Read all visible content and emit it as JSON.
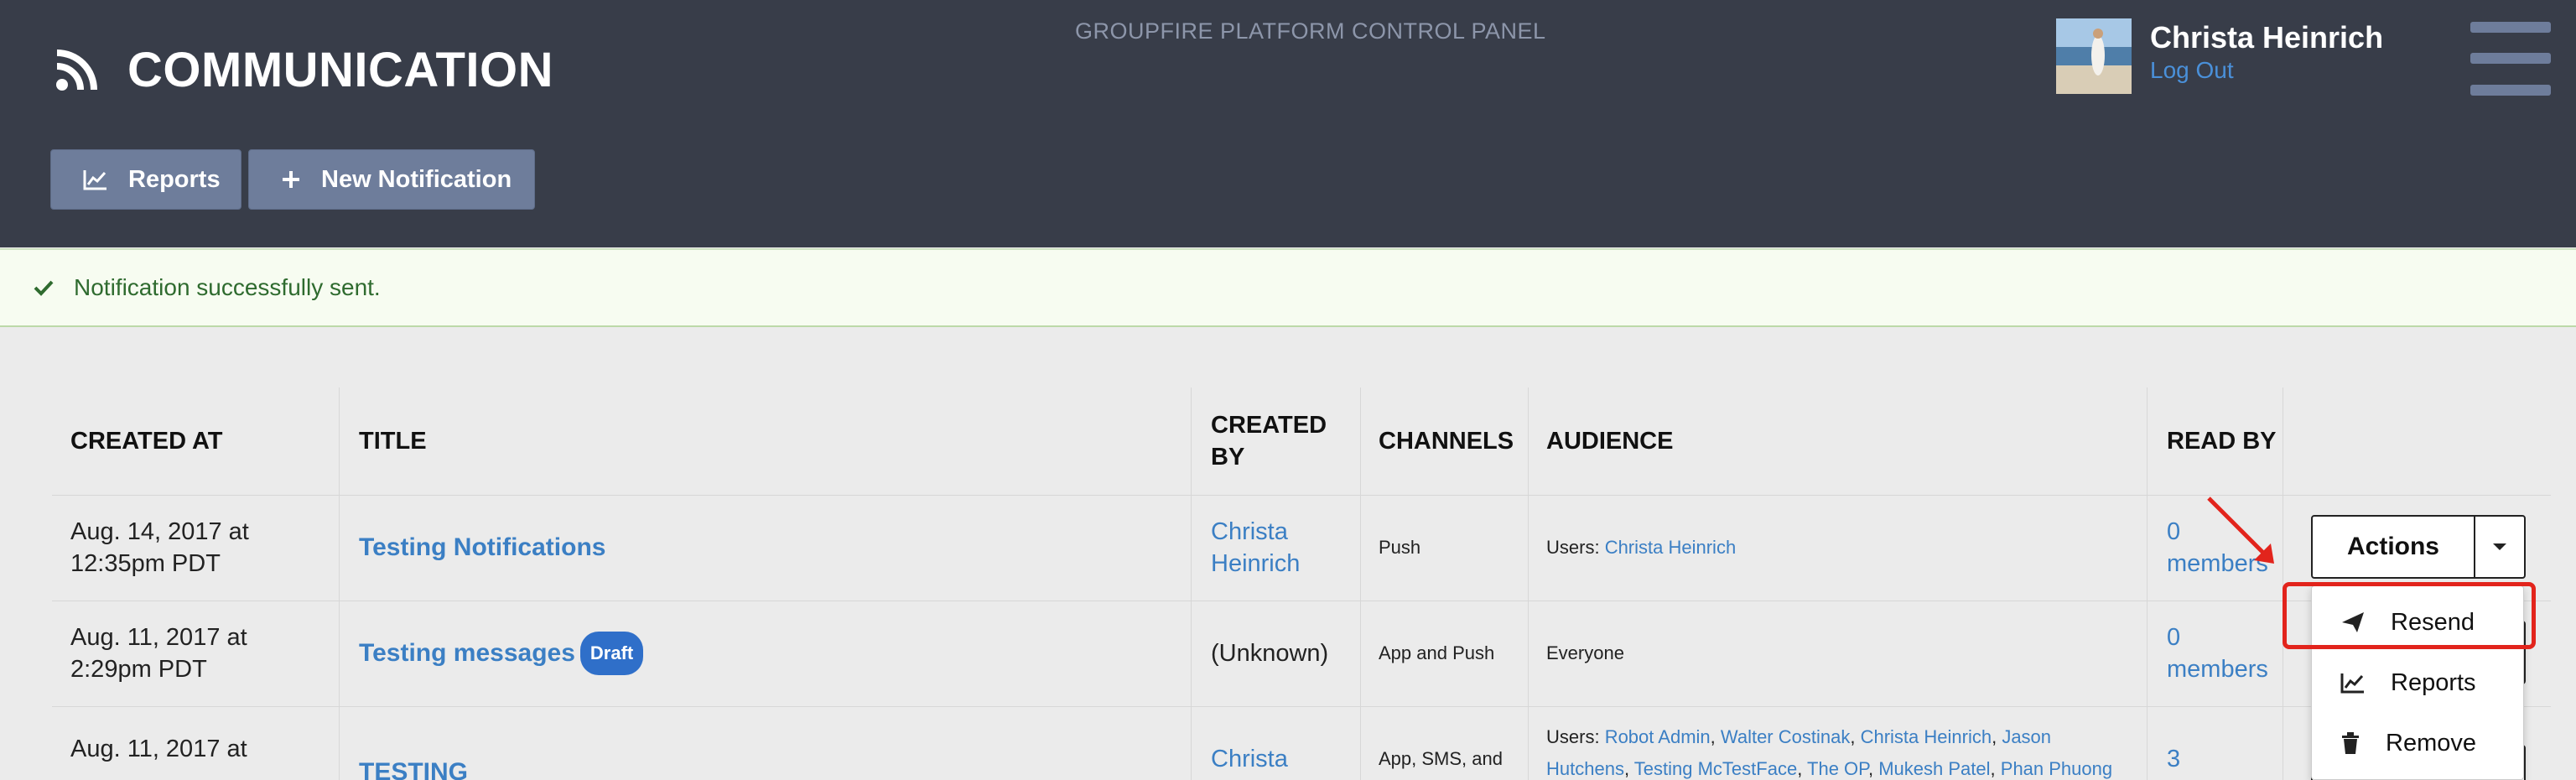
{
  "header": {
    "platform_name": "GROUPFIRE PLATFORM CONTROL PANEL",
    "page_title": "COMMUNICATION",
    "user_name": "Christa Heinrich",
    "logout_label": "Log Out",
    "buttons": {
      "reports": "Reports",
      "new_notification": "New Notification"
    }
  },
  "alert": {
    "message": "Notification successfully sent.",
    "icon": "check-icon"
  },
  "table": {
    "columns": [
      "CREATED AT",
      "TITLE",
      "CREATED BY",
      "CHANNELS",
      "AUDIENCE",
      "READ BY"
    ],
    "rows": [
      {
        "created_at": "Aug. 14, 2017 at 12:35pm PDT",
        "title": "Testing Notifications",
        "created_by": "Christa Heinrich",
        "channels": "Push",
        "audience_label": "Users: ",
        "audience_users": [
          "Christa Heinrich"
        ],
        "read_by": "0 members"
      },
      {
        "created_at": "Aug. 11, 2017 at 2:29pm PDT",
        "title": "Testing messages",
        "badge": "Draft",
        "created_by": "(Unknown)",
        "channels": "App and Push",
        "audience": "Everyone",
        "read_by": "0 members"
      },
      {
        "created_at": "Aug. 11, 2017 at",
        "title": "TESTING",
        "created_by": "Christa",
        "channels": "App, SMS, and",
        "audience_label": "Users: ",
        "audience_users": [
          "Robot Admin",
          "Walter Costinak",
          "Christa Heinrich",
          "Jason Hutchens",
          "Testing McTestFace",
          "The OP",
          "Mukesh Patel",
          "Phan Phuong"
        ],
        "read_by": "3"
      }
    ]
  },
  "actions": {
    "button_label": "Actions",
    "menu": [
      {
        "label": "Resend",
        "icon": "paper-plane-icon"
      },
      {
        "label": "Reports",
        "icon": "line-chart-icon"
      },
      {
        "label": "Remove",
        "icon": "trash-icon"
      }
    ]
  },
  "colors": {
    "header_bg": "#383d49",
    "button_bg": "#6e7d9b",
    "link": "#3b7fc4",
    "alert_bg": "#f7fcf1",
    "highlight": "#e2241c"
  }
}
